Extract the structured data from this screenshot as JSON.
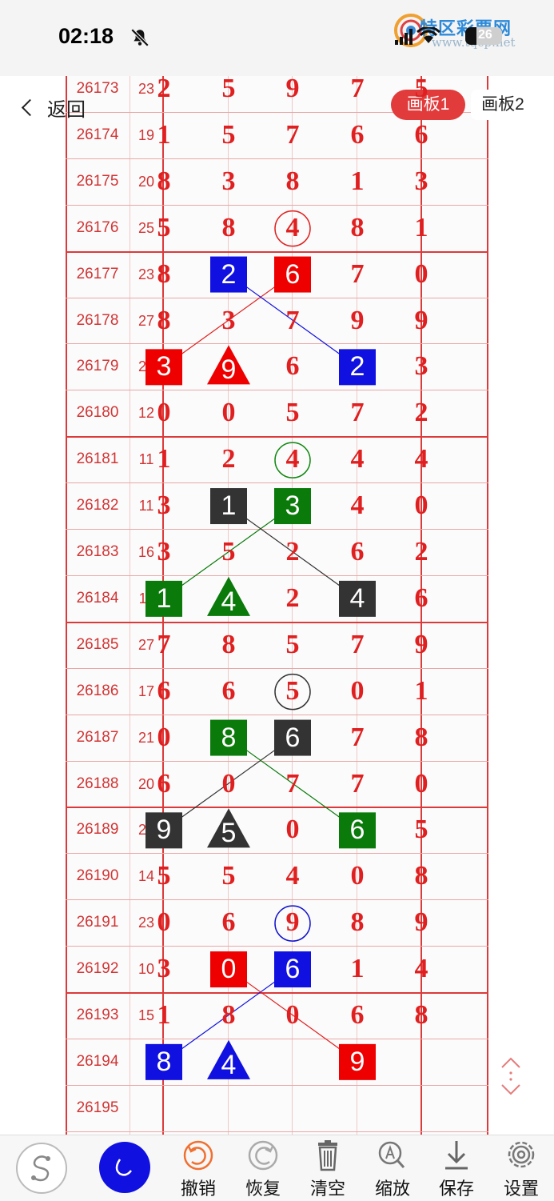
{
  "status_bar": {
    "time": "02:18"
  },
  "watermark": {
    "title": "特区彩票网",
    "subtitle": "www.tqcp.net"
  },
  "battery": {
    "level": "26"
  },
  "nav": {
    "back_label": "返回",
    "tab1_label": "画板1",
    "tab2_label": "画板2",
    "active_tab": "画板1"
  },
  "rows": [
    {
      "period": "26173",
      "sum": "23",
      "digits": [
        "2",
        "5",
        "9",
        "7",
        "5"
      ]
    },
    {
      "period": "26174",
      "sum": "19",
      "digits": [
        "1",
        "5",
        "7",
        "6",
        "6"
      ]
    },
    {
      "period": "26175",
      "sum": "20",
      "digits": [
        "8",
        "3",
        "8",
        "1",
        "3"
      ]
    },
    {
      "period": "26176",
      "sum": "25",
      "digits": [
        "5",
        "8",
        "4",
        "8",
        "1"
      ]
    },
    {
      "period": "26177",
      "sum": "23",
      "digits": [
        "8",
        "2",
        "6",
        "7",
        "0"
      ]
    },
    {
      "period": "26178",
      "sum": "27",
      "digits": [
        "8",
        "3",
        "7",
        "9",
        "9"
      ]
    },
    {
      "period": "26179",
      "sum": "20",
      "digits": [
        "3",
        "9",
        "6",
        "2",
        "3"
      ]
    },
    {
      "period": "26180",
      "sum": "12",
      "digits": [
        "0",
        "0",
        "5",
        "7",
        "2"
      ]
    },
    {
      "period": "26181",
      "sum": "11",
      "digits": [
        "1",
        "2",
        "4",
        "4",
        "4"
      ]
    },
    {
      "period": "26182",
      "sum": "11",
      "digits": [
        "3",
        "1",
        "3",
        "4",
        "0"
      ]
    },
    {
      "period": "26183",
      "sum": "16",
      "digits": [
        "3",
        "5",
        "2",
        "6",
        "2"
      ]
    },
    {
      "period": "26184",
      "sum": "11",
      "digits": [
        "1",
        "4",
        "2",
        "4",
        "6"
      ]
    },
    {
      "period": "26185",
      "sum": "27",
      "digits": [
        "7",
        "8",
        "5",
        "7",
        "9"
      ]
    },
    {
      "period": "26186",
      "sum": "17",
      "digits": [
        "6",
        "6",
        "5",
        "0",
        "1"
      ]
    },
    {
      "period": "26187",
      "sum": "21",
      "digits": [
        "0",
        "8",
        "6",
        "7",
        "8"
      ]
    },
    {
      "period": "26188",
      "sum": "20",
      "digits": [
        "6",
        "0",
        "7",
        "7",
        "0"
      ]
    },
    {
      "period": "26189",
      "sum": "20",
      "digits": [
        "9",
        "5",
        "0",
        "6",
        "5"
      ]
    },
    {
      "period": "26190",
      "sum": "14",
      "digits": [
        "5",
        "5",
        "4",
        "0",
        "8"
      ]
    },
    {
      "period": "26191",
      "sum": "23",
      "digits": [
        "0",
        "6",
        "9",
        "8",
        "9"
      ]
    },
    {
      "period": "26192",
      "sum": "10",
      "digits": [
        "3",
        "0",
        "6",
        "1",
        "4"
      ]
    },
    {
      "period": "26193",
      "sum": "15",
      "digits": [
        "1",
        "8",
        "0",
        "6",
        "8"
      ]
    },
    {
      "period": "26194",
      "sum": "",
      "digits": [
        "8",
        "4",
        "",
        "9",
        ""
      ]
    },
    {
      "period": "26195",
      "sum": "",
      "digits": [
        "",
        "",
        "",
        "",
        ""
      ]
    }
  ],
  "marks": [
    {
      "row": 3,
      "col": 2,
      "shape": "circle",
      "color": "#e02020"
    },
    {
      "row": 4,
      "col": 1,
      "shape": "square",
      "color": "#1010e0"
    },
    {
      "row": 4,
      "col": 2,
      "shape": "square",
      "color": "#ee0000"
    },
    {
      "row": 6,
      "col": 0,
      "shape": "square",
      "color": "#ee0000"
    },
    {
      "row": 6,
      "col": 1,
      "shape": "triangle",
      "color": "#ee0000"
    },
    {
      "row": 6,
      "col": 3,
      "shape": "square",
      "color": "#1010e0"
    },
    {
      "row": 8,
      "col": 2,
      "shape": "circle",
      "color": "#118811"
    },
    {
      "row": 9,
      "col": 1,
      "shape": "square",
      "color": "#333333"
    },
    {
      "row": 9,
      "col": 2,
      "shape": "square",
      "color": "#0a7a0a"
    },
    {
      "row": 11,
      "col": 0,
      "shape": "square",
      "color": "#0a7a0a"
    },
    {
      "row": 11,
      "col": 1,
      "shape": "triangle",
      "color": "#0a7a0a"
    },
    {
      "row": 11,
      "col": 3,
      "shape": "square",
      "color": "#333333"
    },
    {
      "row": 13,
      "col": 2,
      "shape": "circle",
      "color": "#333333"
    },
    {
      "row": 14,
      "col": 1,
      "shape": "square",
      "color": "#0a7a0a"
    },
    {
      "row": 14,
      "col": 2,
      "shape": "square",
      "color": "#333333"
    },
    {
      "row": 16,
      "col": 0,
      "shape": "square",
      "color": "#333333"
    },
    {
      "row": 16,
      "col": 1,
      "shape": "triangle",
      "color": "#333333"
    },
    {
      "row": 16,
      "col": 3,
      "shape": "square",
      "color": "#0a7a0a"
    },
    {
      "row": 18,
      "col": 2,
      "shape": "circle",
      "color": "#1010cc"
    },
    {
      "row": 19,
      "col": 1,
      "shape": "square",
      "color": "#ee0000"
    },
    {
      "row": 19,
      "col": 2,
      "shape": "square",
      "color": "#1010e0"
    },
    {
      "row": 21,
      "col": 0,
      "shape": "square",
      "color": "#1010e0"
    },
    {
      "row": 21,
      "col": 1,
      "shape": "triangle",
      "color": "#1010e0"
    },
    {
      "row": 21,
      "col": 3,
      "shape": "square",
      "color": "#ee0000"
    }
  ],
  "connectors": [
    {
      "from": [
        4,
        2
      ],
      "to": [
        6,
        0
      ],
      "color": "#e02020"
    },
    {
      "from": [
        4,
        1
      ],
      "to": [
        6,
        3
      ],
      "color": "#1010e0"
    },
    {
      "from": [
        9,
        2
      ],
      "to": [
        11,
        0
      ],
      "color": "#0a7a0a"
    },
    {
      "from": [
        9,
        1
      ],
      "to": [
        11,
        3
      ],
      "color": "#333333"
    },
    {
      "from": [
        14,
        2
      ],
      "to": [
        16,
        0
      ],
      "color": "#333333"
    },
    {
      "from": [
        14,
        1
      ],
      "to": [
        16,
        3
      ],
      "color": "#0a7a0a"
    },
    {
      "from": [
        19,
        2
      ],
      "to": [
        21,
        0
      ],
      "color": "#1010e0"
    },
    {
      "from": [
        19,
        1
      ],
      "to": [
        21,
        3
      ],
      "color": "#e02020"
    }
  ],
  "toolbar": {
    "undo_label": "撤销",
    "redo_label": "恢复",
    "clear_label": "清空",
    "zoom_label": "缩放",
    "save_label": "保存",
    "settings_label": "设置"
  },
  "colors": {
    "accent": "#e23b3b",
    "grid_major": "#dc3a3a",
    "digit": "#e02020",
    "pen_active": "#1010e0"
  }
}
